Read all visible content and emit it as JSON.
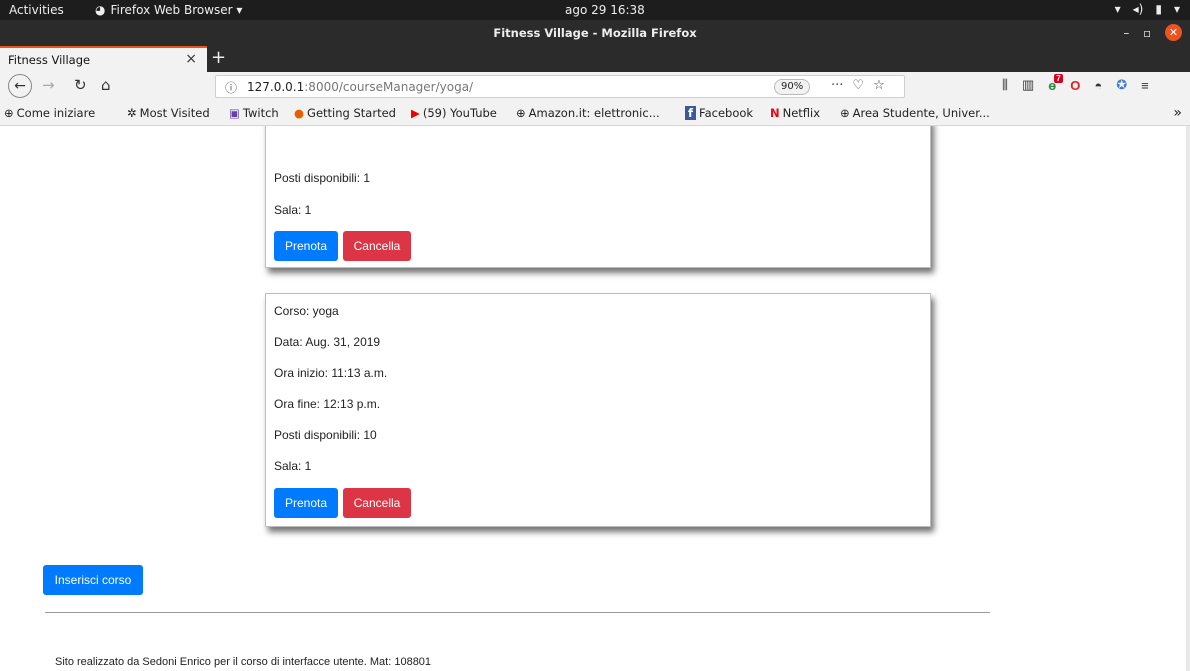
{
  "os_bar": {
    "activities": "Activities",
    "app_menu": "Firefox Web Browser ▾",
    "clock": "ago 29  16:38"
  },
  "window": {
    "title": "Fitness Village - Mozilla Firefox"
  },
  "tab": {
    "title": "Fitness Village",
    "close": "×",
    "new_tab": "+"
  },
  "navbar": {
    "url_host": "127.0.0.1",
    "url_rest": ":8000/courseManager/yoga/",
    "zoom": "90%",
    "page_actions": "···",
    "extension_badge_count": "7"
  },
  "bookmarks": [
    {
      "icon": "globe-icon",
      "glyph": "⊕",
      "label": "Come iniziare"
    },
    {
      "icon": "gear-icon",
      "glyph": "✲",
      "label": "Most Visited"
    },
    {
      "icon": "twitch-icon",
      "glyph": "▣",
      "label": "Twitch"
    },
    {
      "icon": "firefox-icon",
      "glyph": "●",
      "label": "Getting Started"
    },
    {
      "icon": "youtube-icon",
      "glyph": "▶",
      "label": "(59) YouTube"
    },
    {
      "icon": "globe-icon",
      "glyph": "⊕",
      "label": "Amazon.it: elettronic..."
    },
    {
      "icon": "facebook-icon",
      "glyph": "f",
      "label": "Facebook"
    },
    {
      "icon": "netflix-icon",
      "glyph": "N",
      "label": "Netflix"
    },
    {
      "icon": "globe-icon",
      "glyph": "⊕",
      "label": "Area Studente, Univer..."
    }
  ],
  "cards": [
    {
      "lines": [
        "Posti disponibili: 1",
        "Sala: 1"
      ],
      "book_label": "Prenota",
      "delete_label": "Cancella"
    },
    {
      "lines": [
        "Corso: yoga",
        "Data: Aug. 31, 2019",
        "Ora inizio: 11:13 a.m.",
        "Ora fine: 12:13 p.m.",
        "Posti disponibili: 10",
        "Sala: 1"
      ],
      "book_label": "Prenota",
      "delete_label": "Cancella"
    }
  ],
  "insert_course_label": "Inserisci corso",
  "footer_text": "Sito realizzato da Sedoni Enrico per il corso di interfacce utente. Mat: 108801",
  "colors": {
    "primary": "#007bff",
    "danger": "#dc3545",
    "ubuntu_orange": "#e95420"
  }
}
